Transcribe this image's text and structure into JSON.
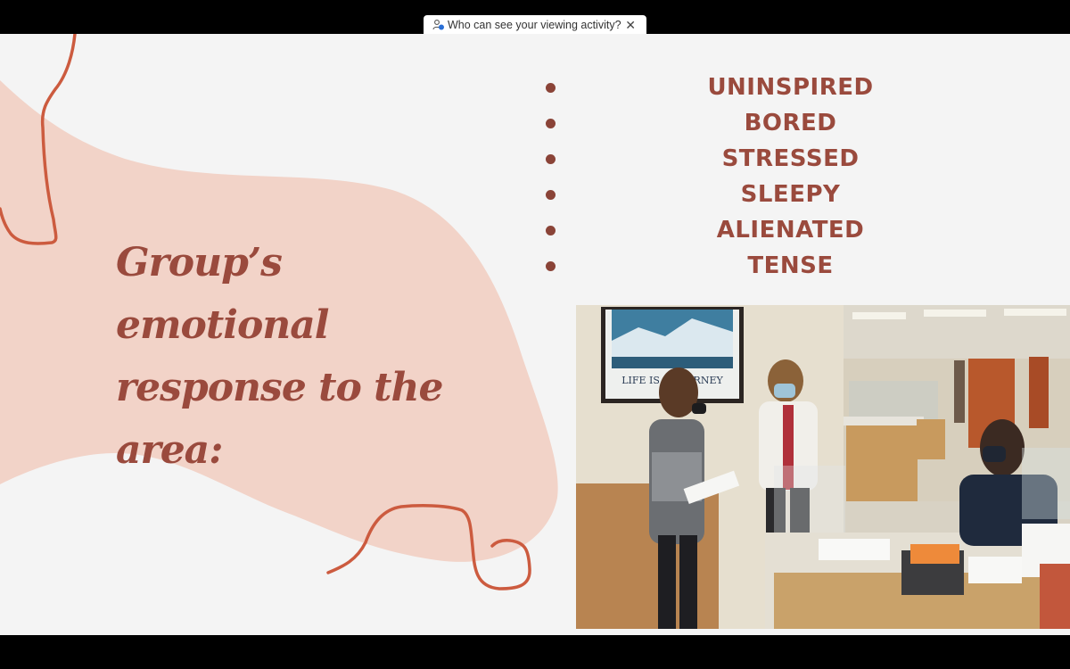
{
  "banner": {
    "text": "Who can see your viewing activity?",
    "icon": "people-icon",
    "close_icon": "close-icon"
  },
  "slide": {
    "heading": "Group’s emotional response to the area:",
    "responses": [
      "UNINSPIRED",
      "BORED",
      "STRESSED",
      "SLEEPY",
      "ALIENATED",
      "TENSE"
    ],
    "photo": {
      "poster_caption": "LIFE IS A JOURNEY"
    }
  },
  "colors": {
    "slide_background": "#f4f4f4",
    "blob": "#f2d3c8",
    "accent_stroke": "#cc5b3f",
    "text": "#9a4a3d"
  }
}
